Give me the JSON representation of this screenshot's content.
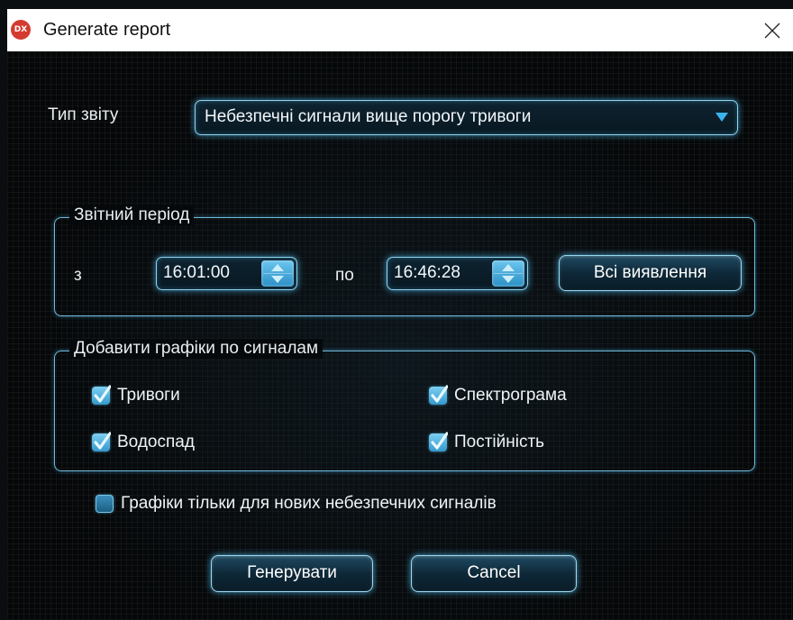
{
  "window": {
    "title": "Generate report",
    "app_icon_text": "DX"
  },
  "report_type": {
    "label": "Тип звіту",
    "selected": "Небезпечні сигнали вище порогу тривоги"
  },
  "period": {
    "group_title": "Звітний період",
    "from_label": "з",
    "from_value": "16:01:00",
    "to_label": "по",
    "to_value": "16:46:28",
    "all_button": "Всі виявлення"
  },
  "charts": {
    "group_title": "Добавити графіки по сигналам",
    "options": [
      {
        "label": "Тривоги",
        "checked": true
      },
      {
        "label": "Спектрограма",
        "checked": true
      },
      {
        "label": "Водоспад",
        "checked": true
      },
      {
        "label": "Постійність",
        "checked": true
      }
    ]
  },
  "new_only": {
    "label": "Графіки тільки для нових небезпечних сигналів",
    "checked": false
  },
  "actions": {
    "generate": "Генерувати",
    "cancel": "Cancel"
  },
  "colors": {
    "accent": "#3ab4ee",
    "background": "#050708",
    "glow": "#8fd3ef"
  },
  "icons": {
    "close": "close-icon",
    "dropdown": "chevron-down-icon",
    "spinner": "spinner-arrows-icon",
    "check": "check-icon"
  }
}
